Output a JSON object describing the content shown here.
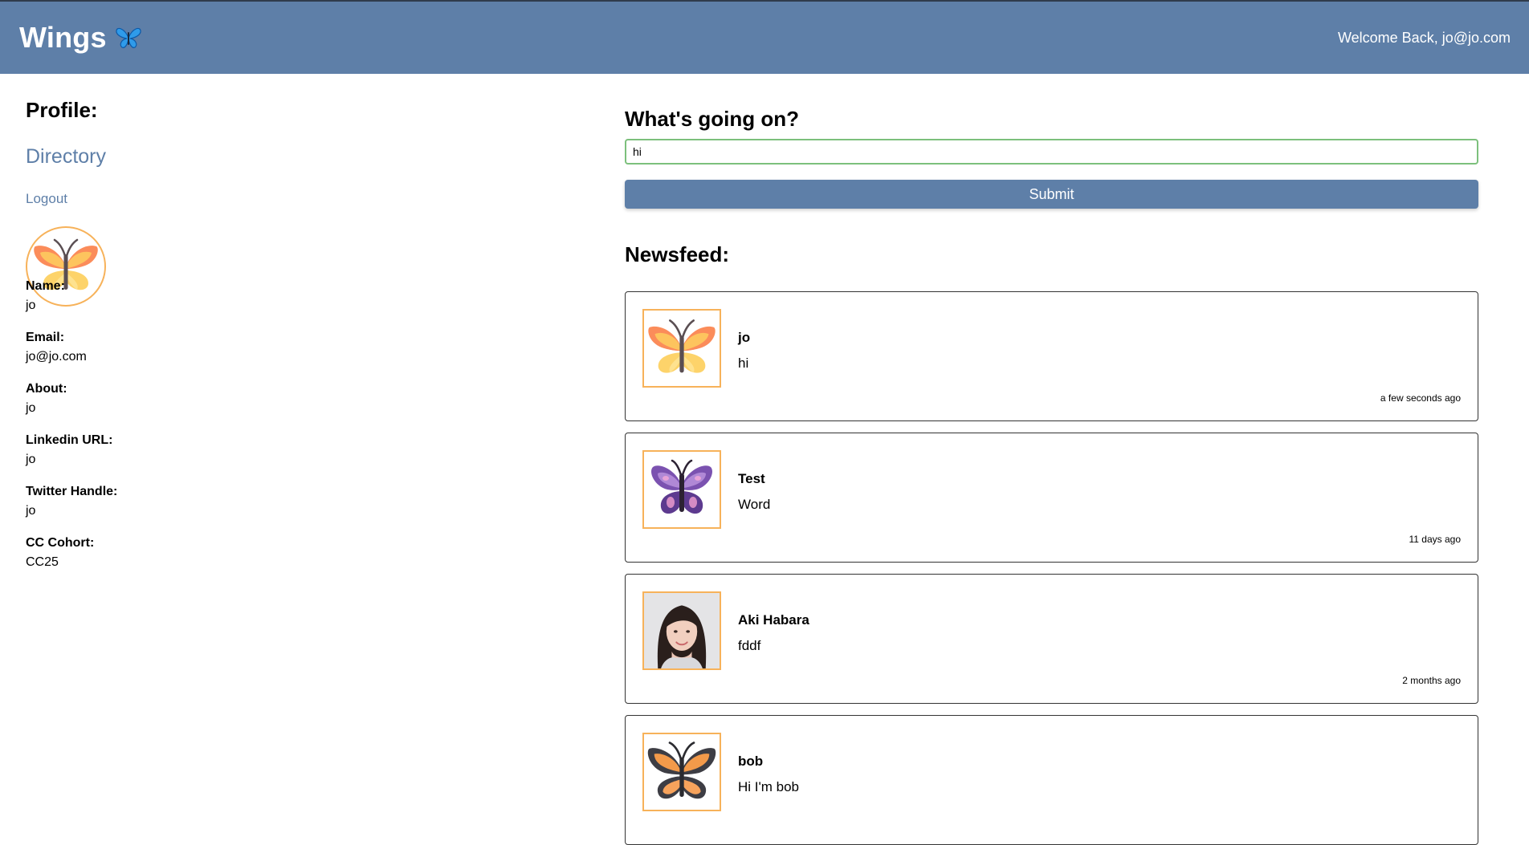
{
  "app": {
    "brand": "Wings",
    "brand_icon": "butterfly-icon",
    "welcome": "Welcome Back, jo@jo.com",
    "colors": {
      "nav": "#5e7fa8",
      "link": "#5e7fa8",
      "avatar_border": "#f7b25a",
      "input_focus": "#7cc07c"
    }
  },
  "profile": {
    "title": "Profile:",
    "directory_link": "Directory",
    "logout_link": "Logout",
    "avatar": "orange-butterfly",
    "fields": [
      {
        "label": "Name:",
        "value": "jo"
      },
      {
        "label": "Email:",
        "value": "jo@jo.com"
      },
      {
        "label": "About:",
        "value": "jo"
      },
      {
        "label": "Linkedin URL:",
        "value": "jo"
      },
      {
        "label": "Twitter Handle:",
        "value": "jo"
      },
      {
        "label": "CC Cohort:",
        "value": "CC25"
      }
    ]
  },
  "composer": {
    "title": "What's going on?",
    "input_value": "hi",
    "submit_label": "Submit"
  },
  "newsfeed": {
    "title": "Newsfeed:",
    "posts": [
      {
        "author": "jo",
        "message": "hi",
        "time": "a few seconds ago",
        "avatar": "orange-butterfly"
      },
      {
        "author": "Test",
        "message": "Word",
        "time": "11 days ago",
        "avatar": "purple-butterfly"
      },
      {
        "author": "Aki Habara",
        "message": "fddf",
        "time": "2 months ago",
        "avatar": "person-photo"
      },
      {
        "author": "bob",
        "message": "Hi I'm bob",
        "time": "",
        "avatar": "monarch-butterfly"
      }
    ]
  }
}
